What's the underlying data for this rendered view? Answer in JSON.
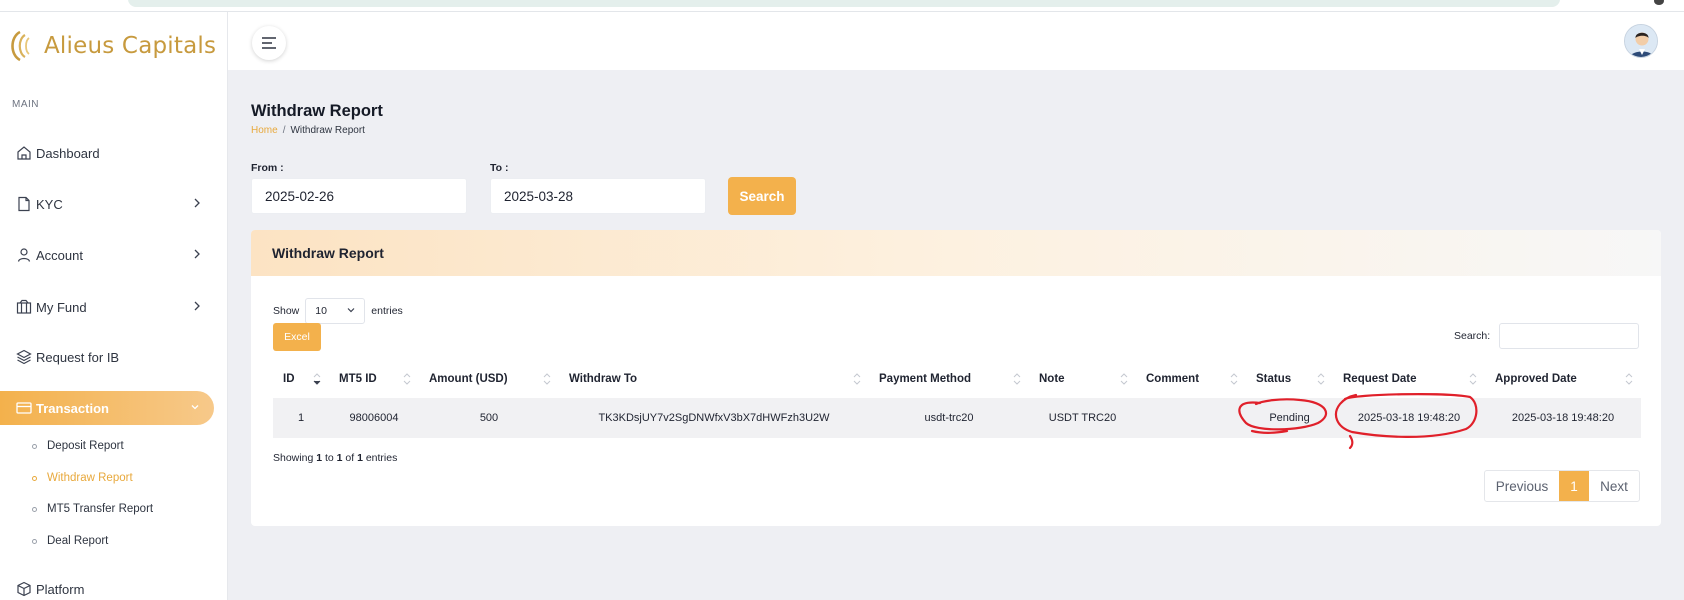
{
  "brand": {
    "name": "Alieus Capitals"
  },
  "sidebar": {
    "section_label": "MAIN",
    "items": [
      {
        "label": "Dashboard",
        "icon": "home-icon"
      },
      {
        "label": "KYC",
        "icon": "file-icon"
      },
      {
        "label": "Account",
        "icon": "user-icon"
      },
      {
        "label": "My Fund",
        "icon": "wallet-icon"
      },
      {
        "label": "Request for IB",
        "icon": "layers-icon"
      },
      {
        "label": "Transaction",
        "icon": "card-icon"
      },
      {
        "label": "Platform",
        "icon": "box-icon"
      }
    ],
    "sub_items": [
      {
        "label": "Deposit Report"
      },
      {
        "label": "Withdraw Report"
      },
      {
        "label": "MT5 Transfer Report"
      },
      {
        "label": "Deal Report"
      }
    ]
  },
  "page": {
    "title": "Withdraw Report",
    "breadcrumb_home": "Home",
    "breadcrumb_separator": "/",
    "breadcrumb_current": "Withdraw Report"
  },
  "filters": {
    "from_label": "From :",
    "from_value": "2025-02-26",
    "to_label": "To :",
    "to_value": "2025-03-28",
    "search_button": "Search"
  },
  "report": {
    "card_title": "Withdraw Report",
    "show_label": "Show",
    "entries_value": "10",
    "entries_label": "entries",
    "excel_button": "Excel",
    "search_label": "Search:",
    "columns": [
      "ID",
      "MT5 ID",
      "Amount (USD)",
      "Withdraw To",
      "Payment Method",
      "Note",
      "Comment",
      "Status",
      "Request Date",
      "Approved Date"
    ],
    "rows": [
      {
        "id": "1",
        "mt5_id": "98006004",
        "amount": "500",
        "withdraw_to": "TK3KDsjUY7v2SgDNWfxV3bX7dHWFzh3U2W",
        "payment_method": "usdt-trc20",
        "note": "USDT TRC20",
        "comment": "",
        "status": "Pending",
        "request_date": "2025-03-18 19:48:20",
        "approved_date": "2025-03-18 19:48:20"
      }
    ],
    "showing_prefix": "Showing ",
    "showing_start": "1",
    "showing_to": " to ",
    "showing_end": "1",
    "showing_of": " of ",
    "showing_total": "1",
    "showing_suffix": " entries",
    "pagination": {
      "previous": "Previous",
      "current": "1",
      "next": "Next"
    }
  },
  "colors": {
    "accent": "#f3b14c",
    "brand_gold": "#c79a3e",
    "annotation_red": "#e0202a"
  }
}
